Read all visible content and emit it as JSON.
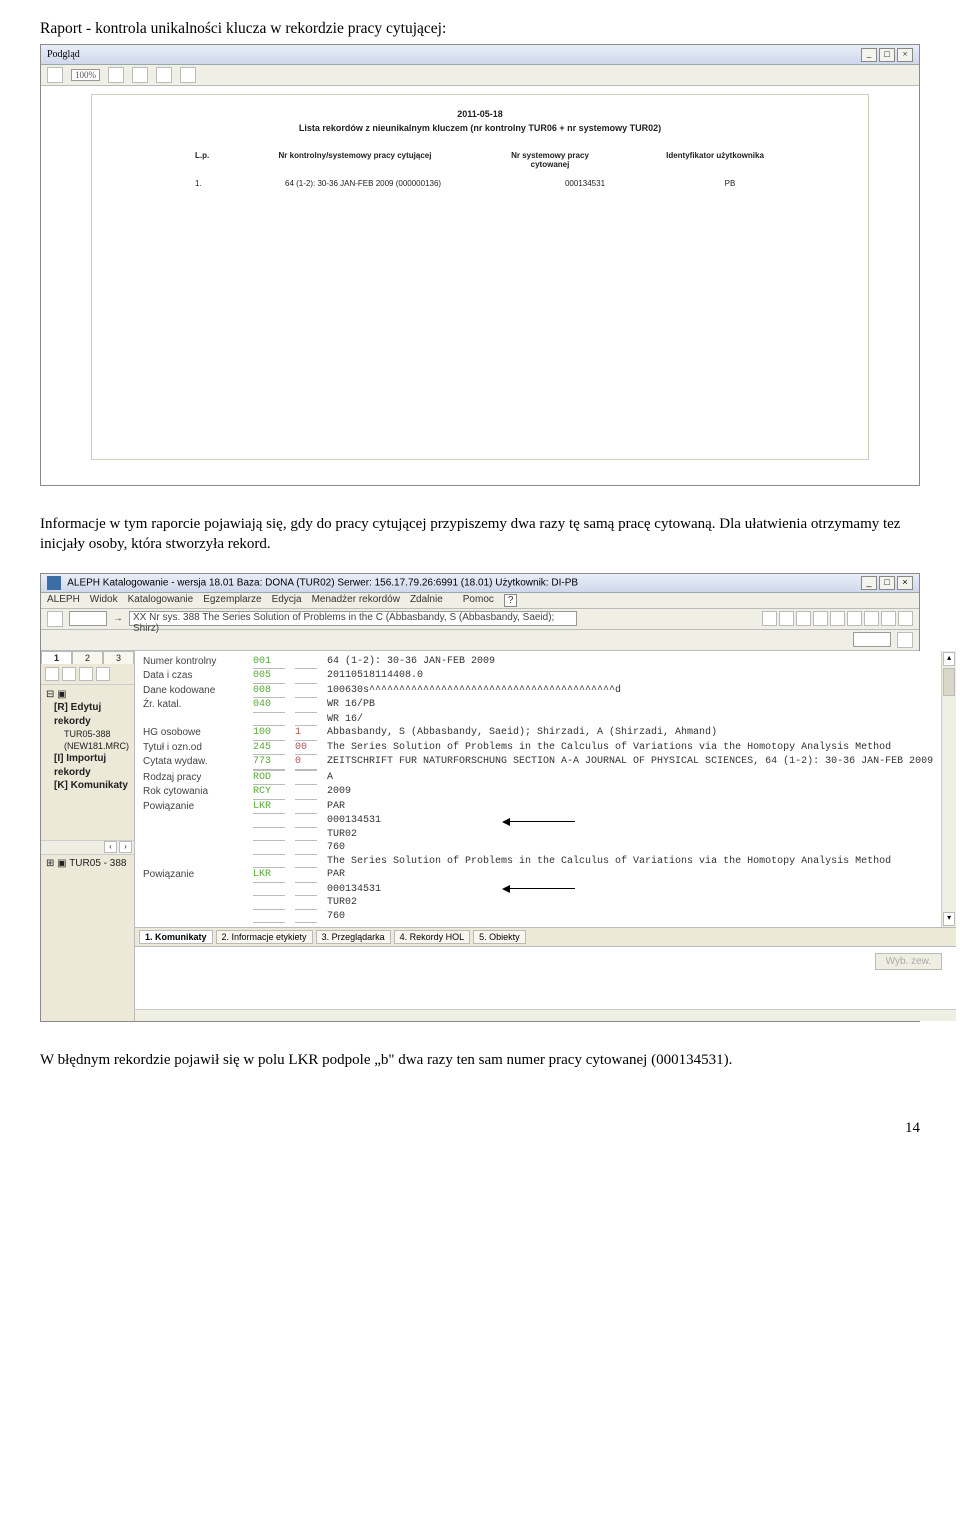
{
  "text": {
    "heading": "Raport - kontrola unikalności klucza w rekordzie pracy cytującej:",
    "para1": "Informacje w tym raporcie pojawiają się, gdy do pracy cytującej przypiszemy dwa razy tę samą pracę cytowaną. Dla ułatwienia otrzymamy tez inicjały osoby, która stworzyła rekord.",
    "para2": "W błędnym rekordzie pojawił się w polu LKR podpole „b\" dwa razy ten sam numer pracy cytowanej (000134531).",
    "page": "14"
  },
  "preview": {
    "title": "Podgląd",
    "zoom": "100%",
    "report_date": "2011-05-18",
    "report_title": "Lista rekordów z nieunikalnym kluczem (nr kontrolny TUR06 + nr systemowy TUR02)",
    "col_lp": "L.p.",
    "col1": "Nr kontrolny/systemowy pracy cytującej",
    "col2": "Nr systemowy pracy cytowanej",
    "col3": "Identyfikator użytkownika",
    "row_lp": "1.",
    "row_c1": "64 (1-2): 30-36 JAN-FEB 2009  (000000136)",
    "row_c2": "000134531",
    "row_c3": "PB"
  },
  "aleph": {
    "title": "ALEPH Katalogowanie - wersja 18.01 Baza: DONA (TUR02) Serwer: 156.17.79.26:6991 (18.01) Użytkownik: DI-PB",
    "menu": [
      "ALEPH",
      "Widok",
      "Katalogowanie",
      "Egzemplarze",
      "Edycja",
      "Menadżer rekordów",
      "Zdalnie",
      "        ",
      "Pomoc"
    ],
    "help_icon": "?",
    "search_prefix": "→",
    "search_text": "XX Nr sys. 388 The Series Solution of Problems in the C (Abbasbandy, S (Abbasbandy, Saeid); Shirz)",
    "tree_tabs": [
      "1",
      "2",
      "3"
    ],
    "tree_items": [
      {
        "label": "[R] Edytuj rekordy",
        "bold": true
      },
      {
        "label": "TUR05-388 (NEW181.MRC)",
        "sub": true
      },
      {
        "label": "[I] Importuj rekordy",
        "bold": true
      },
      {
        "label": "[K] Komunikaty",
        "bold": true
      }
    ],
    "tree_footer": "TUR05 - 388",
    "bottom_tabs": [
      "1. Komunikaty",
      "2. Informacje etykiety",
      "3. Przeglądarka",
      "4. Rekordy HOL",
      "5. Obiekty"
    ],
    "lower_btn": "Wyb. zew.",
    "records": [
      {
        "label": "Numer kontrolny",
        "tag": "001",
        "ind": "",
        "val": "64 (1-2): 30-36 JAN-FEB 2009"
      },
      {
        "label": "Data i czas",
        "tag": "005",
        "ind": "",
        "val": "20110518114408.0"
      },
      {
        "label": "Dane kodowane",
        "tag": "008",
        "ind": "",
        "val": "100630s^^^^^^^^^^^^^^^^^^^^^^^^^^^^^^^^^^^^^^^^^d"
      },
      {
        "label": "Źr. katal.",
        "tag": "040",
        "ind": "",
        "val": "WR 16/PB"
      },
      {
        "label": "",
        "tag": "",
        "ind": "",
        "val": "WR 16/"
      },
      {
        "label": "HG osobowe",
        "tag": "100",
        "ind": "1",
        "val": "Abbasbandy, S (Abbasbandy, Saeid); Shirzadi, A (Shirzadi, Ahmand)"
      },
      {
        "label": "Tytuł i ozn.od",
        "tag": "245",
        "ind": "00",
        "val": "The Series Solution of Problems in the Calculus of Variations via the Homotopy Analysis Method"
      },
      {
        "label": "Cytata wydaw.",
        "tag": "773",
        "ind": "0",
        "val": "ZEITSCHRIFT FUR NATURFORSCHUNG SECTION A-A JOURNAL OF PHYSICAL SCIENCES, 64 (1-2): 30-36 JAN-FEB 2009"
      },
      {
        "label": "",
        "tag": "",
        "ind": "",
        "val": ""
      },
      {
        "label": "Rodzaj pracy",
        "tag": "ROD",
        "ind": "",
        "val": "A"
      },
      {
        "label": "Rok cytowania",
        "tag": "RCY",
        "ind": "",
        "val": "2009"
      },
      {
        "label": "Powiązanie",
        "tag": "LKR",
        "ind": "",
        "val": "PAR"
      },
      {
        "label": "",
        "tag": "",
        "ind": "",
        "val": "000134531"
      },
      {
        "label": "",
        "tag": "",
        "ind": "",
        "val": "TUR02"
      },
      {
        "label": "",
        "tag": "",
        "ind": "",
        "val": "760"
      },
      {
        "label": "",
        "tag": "",
        "ind": "",
        "val": "The Series Solution of Problems in the Calculus of Variations via the Homotopy Analysis Method"
      },
      {
        "label": "Powiązanie",
        "tag": "LKR",
        "ind": "",
        "val": "PAR"
      },
      {
        "label": "",
        "tag": "",
        "ind": "",
        "val": "000134531"
      },
      {
        "label": "",
        "tag": "",
        "ind": "",
        "val": "TUR02"
      },
      {
        "label": "",
        "tag": "",
        "ind": "",
        "val": "760"
      }
    ]
  }
}
